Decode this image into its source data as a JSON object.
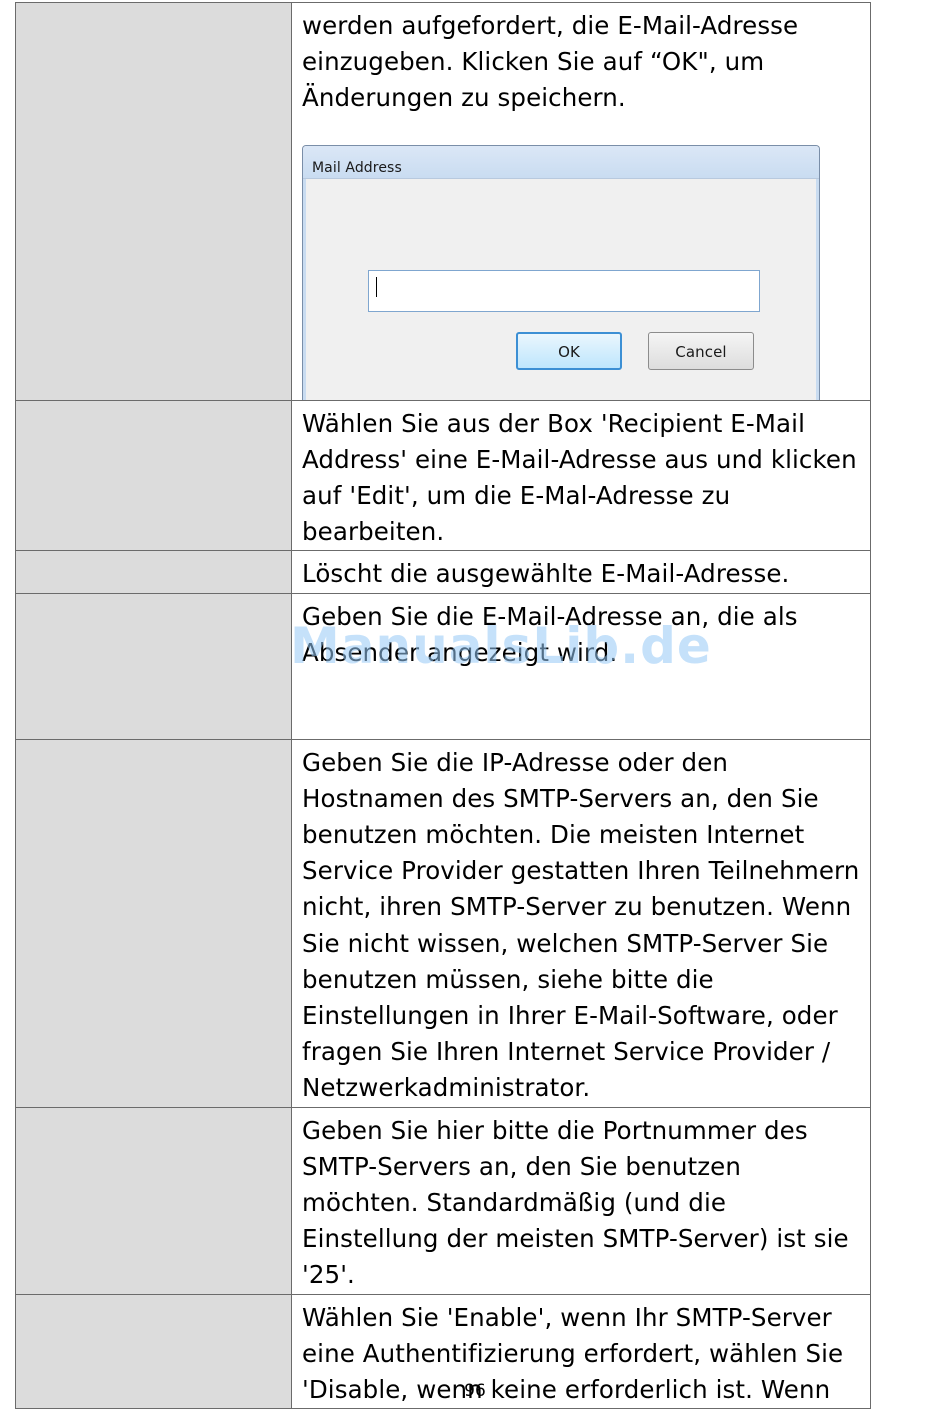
{
  "rows": [
    {
      "text": "werden aufgefordert, die E-Mail-Adresse einzugeben. Klicken Sie auf “OK\", um Änderungen zu speichern.",
      "dialog": {
        "title": "Mail Address",
        "input_value": "",
        "ok_label": "OK",
        "cancel_label": "Cancel"
      }
    },
    {
      "text": "Wählen Sie aus der Box 'Recipient E-Mail Address' eine E-Mail-Adresse aus und klicken auf 'Edit', um die E-Mal-Adresse zu bearbeiten."
    },
    {
      "text": "Löscht die ausgewählte E-Mail-Adresse."
    },
    {
      "text": "Geben Sie die E-Mail-Adresse an, die als Absender angezeigt wird."
    },
    {
      "text": "Geben Sie die IP-Adresse oder den Hostnamen des SMTP-Servers an, den Sie benutzen möchten. Die meisten Internet Service Provider gestatten Ihren Teilnehmern nicht, ihren SMTP-Server zu benutzen. Wenn Sie nicht wissen, welchen SMTP-Server Sie benutzen müssen, siehe bitte die Einstellungen in Ihrer E-Mail-Software, oder fragen Sie Ihren Internet Service Provider / Netzwerkadministrator."
    },
    {
      "text": "Geben Sie hier bitte die Portnummer des SMTP-Servers an, den Sie benutzen möchten. Standardmäßig (und die Einstellung der meisten SMTP-Server) ist sie '25'."
    },
    {
      "text": "Wählen Sie 'Enable', wenn Ihr SMTP-Server eine Authentifizierung erfordert, wählen Sie 'Disable, wenn keine erforderlich ist. Wenn"
    }
  ],
  "watermark": "ManualsLib.de",
  "page_number": "96"
}
